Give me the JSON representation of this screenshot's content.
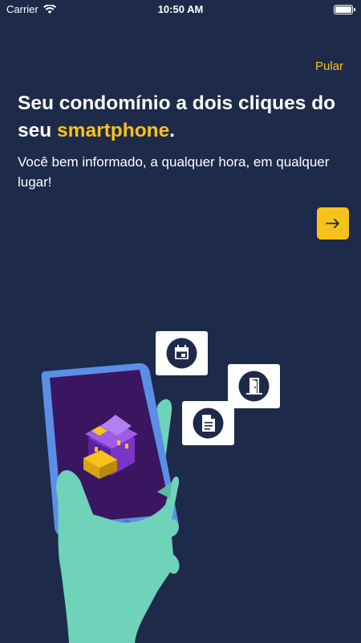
{
  "status_bar": {
    "carrier": "Carrier",
    "time": "10:50 AM"
  },
  "skip_label": "Pular",
  "headline": {
    "part1": "Seu condomínio a dois cliques do seu ",
    "highlight": "smartphone",
    "end": "."
  },
  "subtitle": "Você bem informado, a qualquer hora, em qualquer lugar!",
  "colors": {
    "background": "#1e2a4a",
    "accent": "#f7c31b",
    "hand": "#6ed3b8",
    "phone_screen": "#3a1660"
  },
  "icons": [
    "calendar-icon",
    "door-icon",
    "document-icon",
    "arrow-right-icon"
  ]
}
